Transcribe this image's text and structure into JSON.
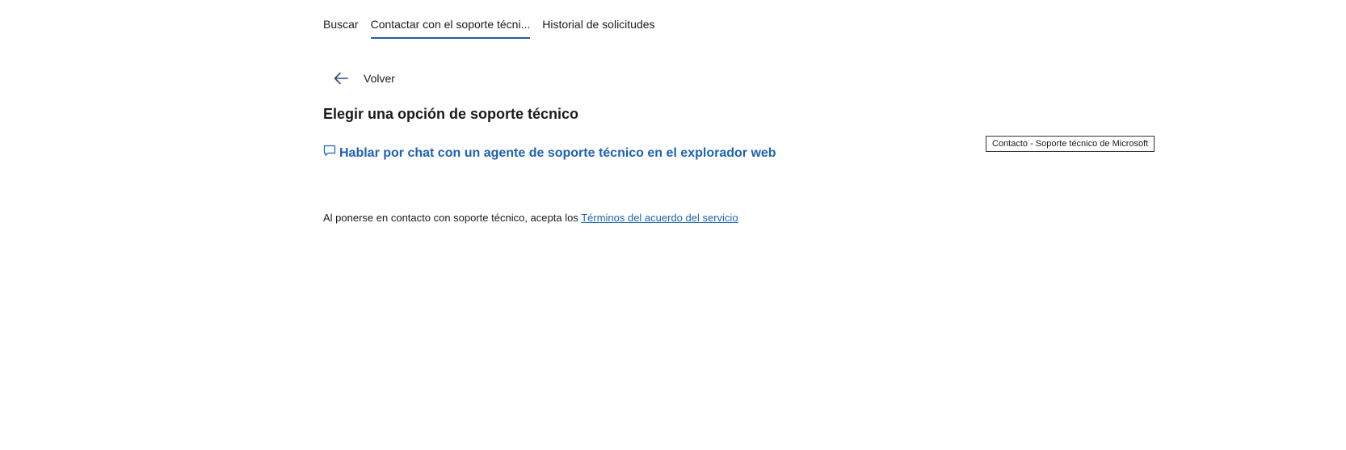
{
  "tabs": [
    {
      "label": "Buscar",
      "active": false
    },
    {
      "label": "Contactar con el soporte técni...",
      "active": true
    },
    {
      "label": "Historial de solicitudes",
      "active": false
    }
  ],
  "back": {
    "label": "Volver",
    "icon": "arrow-left-icon"
  },
  "heading": "Elegir una opción de soporte técnico",
  "chat_option": {
    "label": "Hablar por chat con un agente de soporte técnico en el explorador web",
    "icon": "chat-bubble-icon"
  },
  "terms": {
    "prefix": "Al ponerse en contacto con soporte técnico, acepta los ",
    "link_label": "Términos del acuerdo del servicio"
  },
  "tooltip": "Contacto - Soporte técnico de Microsoft",
  "colors": {
    "accent": "#1f63b0",
    "tab_underline": "#1f5fa8",
    "text": "#1b1b1b"
  }
}
